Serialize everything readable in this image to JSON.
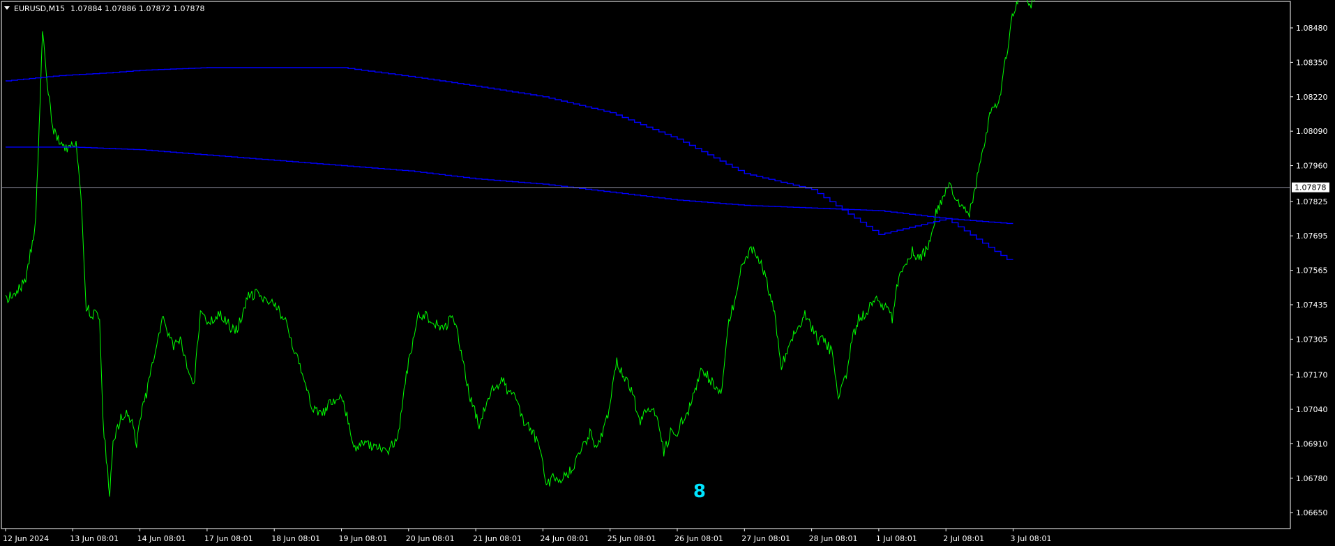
{
  "header": {
    "symbol": "EURUSD,M15",
    "quote": "1.07884 1.07886 1.07872 1.07878"
  },
  "colors": {
    "background": "#000000",
    "frame": "#ffffff",
    "price_line": "#00ff00",
    "ma_line": "#0000ff",
    "marker": "#00e5ff",
    "bid_line": "#8a8a9a"
  },
  "chart_data": {
    "type": "line",
    "title": "",
    "xlabel": "",
    "ylabel": "",
    "ylim": [
      1.0659,
      1.0858
    ],
    "grid": false,
    "current_price": "1.07878",
    "y_ticks": [
      "1.08480",
      "1.08350",
      "1.08220",
      "1.08090",
      "1.07960",
      "1.07825",
      "1.07695",
      "1.07565",
      "1.07435",
      "1.07305",
      "1.07170",
      "1.07040",
      "1.06910",
      "1.06780",
      "1.06650"
    ],
    "x_tick_labels": [
      "12 Jun 2024",
      "13 Jun 08:01",
      "14 Jun 08:01",
      "17 Jun 08:01",
      "18 Jun 08:01",
      "19 Jun 08:01",
      "20 Jun 08:01",
      "21 Jun 08:01",
      "24 Jun 08:01",
      "25 Jun 08:01",
      "26 Jun 08:01",
      "27 Jun 08:01",
      "28 Jun 08:01",
      "1 Jul 08:01",
      "2 Jul 08:01",
      "3 Jul 08:01"
    ],
    "series": [
      {
        "kind": "price",
        "x": [
          0,
          0.3,
          0.45,
          0.55,
          0.62,
          0.7,
          0.85,
          1.0,
          1.05,
          1.12,
          1.2,
          1.3,
          1.4,
          1.45,
          1.55,
          1.6,
          1.7,
          1.8,
          1.9,
          1.95,
          2.0,
          2.1,
          2.2,
          2.3,
          2.35,
          2.5,
          2.6,
          2.7,
          2.8,
          2.9,
          3.0,
          3.1,
          3.2,
          3.35,
          3.45,
          3.6,
          3.75,
          3.85,
          4.0,
          4.15,
          4.3,
          4.4,
          4.45,
          4.55,
          4.7,
          4.9,
          5.0,
          5.2,
          5.35,
          5.5,
          5.7,
          5.85,
          5.95,
          6.05,
          6.15,
          6.35,
          6.45,
          6.55,
          6.65,
          6.75,
          6.9,
          7.05,
          7.2,
          7.3,
          7.4,
          7.5,
          7.6,
          7.7,
          7.8,
          7.95,
          8.05,
          8.15,
          8.3,
          8.45,
          8.6,
          8.7,
          8.8,
          8.95,
          9.1,
          9.3,
          9.45,
          9.6,
          9.7,
          9.8,
          9.9,
          10.0,
          10.08,
          10.2,
          10.35,
          10.5,
          10.65,
          10.75,
          10.85,
          10.95,
          11.1,
          11.25,
          11.35,
          11.45,
          11.55,
          11.7,
          11.9,
          12.0,
          12.1,
          12.2,
          12.3,
          12.4,
          12.5,
          12.6,
          12.7,
          12.8,
          12.9,
          13.0,
          13.1,
          13.2,
          13.3,
          13.4,
          13.5,
          13.6,
          13.7,
          13.75,
          13.85,
          13.95,
          14.05,
          14.2,
          14.35,
          14.5,
          14.65,
          14.8,
          14.9,
          14.97,
          15.1,
          15.2,
          15.25,
          15.32
        ],
        "y": [
          1.0745,
          1.0752,
          1.0775,
          1.0848,
          1.0828,
          1.081,
          1.0802,
          1.0803,
          1.0805,
          1.0785,
          1.0742,
          1.074,
          1.0739,
          1.07,
          1.0672,
          1.069,
          1.07,
          1.0702,
          1.0698,
          1.069,
          1.07,
          1.071,
          1.0722,
          1.0735,
          1.0738,
          1.0728,
          1.073,
          1.072,
          1.0712,
          1.074,
          1.0738,
          1.0737,
          1.074,
          1.0735,
          1.0734,
          1.0746,
          1.0748,
          1.0745,
          1.0745,
          1.0738,
          1.0725,
          1.072,
          1.0715,
          1.0705,
          1.0702,
          1.0708,
          1.071,
          1.069,
          1.0692,
          1.069,
          1.0688,
          1.0695,
          1.0715,
          1.0728,
          1.074,
          1.0738,
          1.0735,
          1.0735,
          1.074,
          1.073,
          1.071,
          1.0698,
          1.071,
          1.0712,
          1.0715,
          1.071,
          1.0708,
          1.07,
          1.0698,
          1.069,
          1.0675,
          1.0678,
          1.0678,
          1.0682,
          1.069,
          1.0695,
          1.069,
          1.07,
          1.0722,
          1.0712,
          1.07,
          1.0705,
          1.07,
          1.0688,
          1.0695,
          1.0695,
          1.07,
          1.0705,
          1.072,
          1.0715,
          1.071,
          1.0735,
          1.0745,
          1.0758,
          1.0765,
          1.076,
          1.075,
          1.074,
          1.072,
          1.073,
          1.074,
          1.0735,
          1.073,
          1.073,
          1.0725,
          1.071,
          1.0715,
          1.073,
          1.0738,
          1.074,
          1.0745,
          1.0746,
          1.0742,
          1.0738,
          1.0755,
          1.076,
          1.0764,
          1.0761,
          1.0764,
          1.0766,
          1.0778,
          1.0784,
          1.0788,
          1.0781,
          1.0778,
          1.0795,
          1.0815,
          1.0822,
          1.0838,
          1.085,
          1.0862,
          1.086,
          1.0857,
          1.0858
        ]
      },
      {
        "kind": "moving-average",
        "x": [
          0,
          0.8,
          1.5,
          2.0,
          3.0,
          4.0,
          5.0,
          5.6,
          6.2,
          7.0,
          8.0,
          9.0,
          10.0,
          11.0,
          12.0,
          13.0,
          14.0,
          15.0
        ],
        "y": [
          1.0828,
          1.083,
          1.0831,
          1.0832,
          1.0833,
          1.0833,
          1.0833,
          1.0831,
          1.0829,
          1.0826,
          1.0822,
          1.0816,
          1.0806,
          1.0793,
          1.0787,
          1.077,
          1.0776,
          1.0759
        ]
      },
      {
        "kind": "moving-average",
        "x": [
          0,
          1.0,
          2.0,
          3.0,
          4.0,
          5.0,
          6.0,
          7.0,
          8.0,
          9.0,
          10.0,
          11.0,
          12.0,
          13.0,
          14.0,
          15.0
        ],
        "y": [
          1.0803,
          1.0803,
          1.0802,
          1.08,
          1.0798,
          1.0796,
          1.0794,
          1.0791,
          1.0789,
          1.0786,
          1.0783,
          1.0781,
          1.078,
          1.0779,
          1.0776,
          1.0774
        ]
      }
    ],
    "markers": [
      {
        "x": 10.32,
        "y": 1.0674,
        "glyph": "8"
      }
    ]
  }
}
